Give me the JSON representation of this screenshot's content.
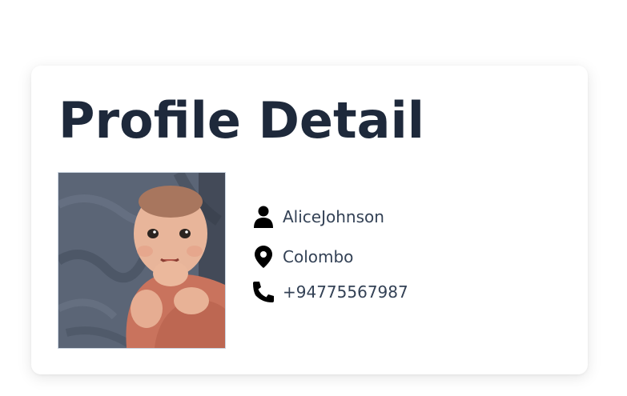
{
  "profile": {
    "title": "Profile Detail",
    "photo_icon": "profile-photo",
    "name": "AliceJohnson",
    "city": "Colombo",
    "phone": "+94775567987",
    "icons": {
      "name": "user-icon",
      "city": "location-pin-icon",
      "phone": "phone-icon"
    }
  }
}
